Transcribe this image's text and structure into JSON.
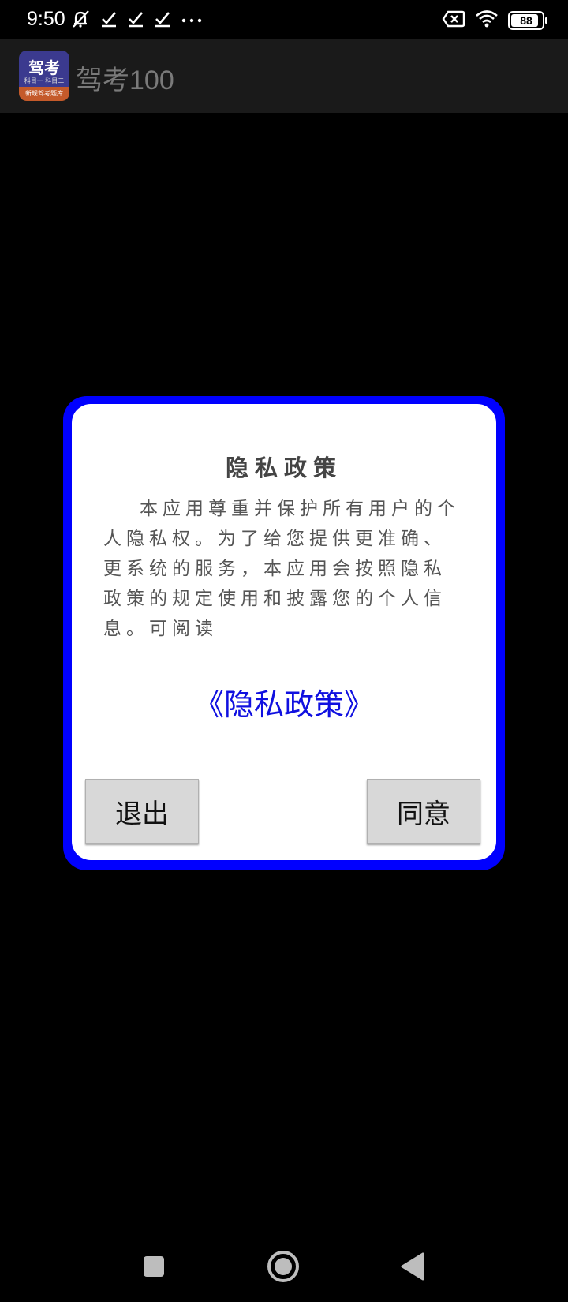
{
  "status_bar": {
    "time": "9:50",
    "battery": "88",
    "left_icons": [
      "mute-bell-icon",
      "check-icon",
      "check-icon",
      "check-icon",
      "more-dots-icon"
    ],
    "right_icons": [
      "no-sim-icon",
      "wifi-icon",
      "battery-icon"
    ]
  },
  "app_bar": {
    "title": "驾考100",
    "icon_text_main": "驾考",
    "icon_text_sub": "科目一 科目二",
    "icon_text_bottom": "新规驾考题库"
  },
  "dialog": {
    "title": "隐私政策",
    "body": "本应用尊重并保护所有用户的个人隐私权。为了给您提供更准确、更系统的服务，本应用会按照隐私政策的规定使用和披露您的个人信息。可阅读",
    "link": "《隐私政策》",
    "exit_label": "退出",
    "agree_label": "同意",
    "frame_color": "#0000ff",
    "link_color": "#1010e0"
  },
  "nav_bar": {
    "icons": [
      "recents-square-icon",
      "home-circle-icon",
      "back-triangle-icon"
    ]
  }
}
